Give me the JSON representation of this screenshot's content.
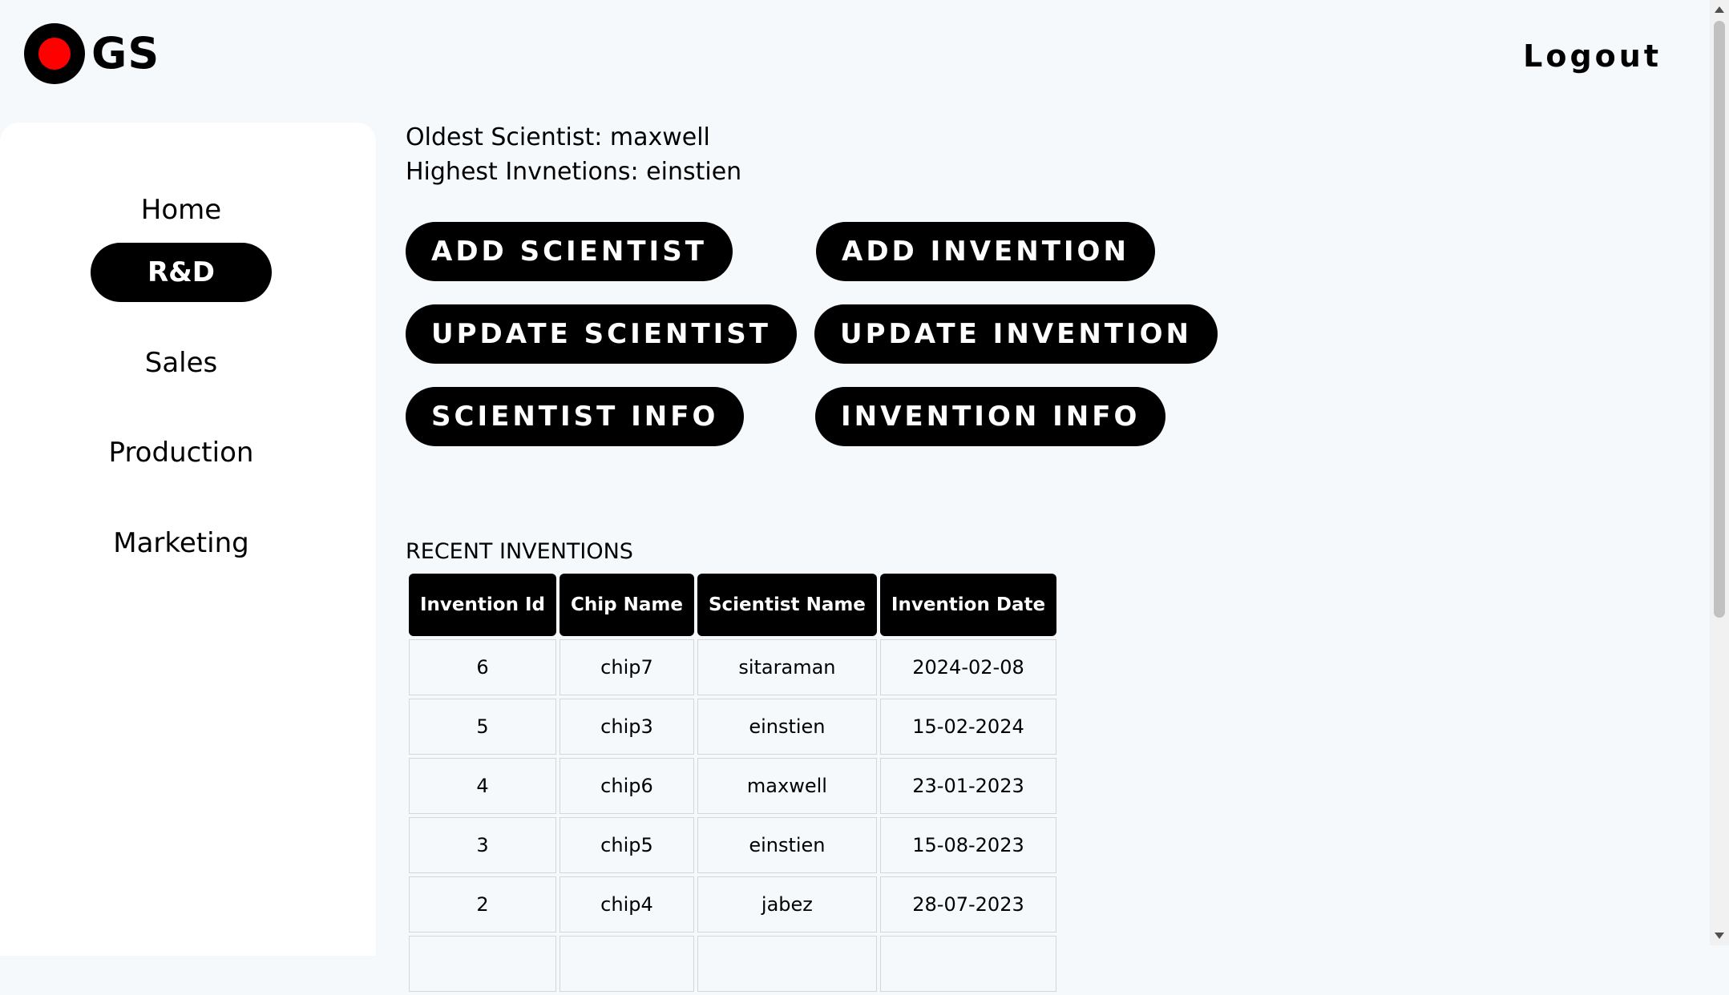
{
  "header": {
    "logo_text": "GS",
    "logout_label": "Logout"
  },
  "sidebar": {
    "items": [
      {
        "label": "Home",
        "active": false
      },
      {
        "label": "R&D",
        "active": true
      },
      {
        "label": "Sales",
        "active": false
      },
      {
        "label": "Production",
        "active": false
      },
      {
        "label": "Marketing",
        "active": false
      }
    ]
  },
  "stats": {
    "oldest": "Oldest Scientist: maxwell",
    "highest": "Highest Invnetions: einstien"
  },
  "actions": {
    "add_scientist": "ADD SCIENTIST",
    "add_invention": "ADD INVENTION",
    "update_scientist": "UPDATE SCIENTIST",
    "update_invention": "UPDATE INVENTION",
    "scientist_info": "SCIENTIST INFO",
    "invention_info": "INVENTION INFO"
  },
  "recent": {
    "title": "RECENT INVENTIONS",
    "columns": [
      "Invention Id",
      "Chip Name",
      "Scientist Name",
      "Invention Date"
    ],
    "rows": [
      [
        "6",
        "chip7",
        "sitaraman",
        "2024-02-08"
      ],
      [
        "5",
        "chip3",
        "einstien",
        "15-02-2024"
      ],
      [
        "4",
        "chip6",
        "maxwell",
        "23-01-2023"
      ],
      [
        "3",
        "chip5",
        "einstien",
        "15-08-2023"
      ],
      [
        "2",
        "chip4",
        "jabez",
        "28-07-2023"
      ],
      [
        "",
        "",
        "",
        ""
      ]
    ]
  },
  "colors": {
    "background": "#f5f9fc",
    "accent": "#000000",
    "logo_dot": "#ff0000"
  }
}
